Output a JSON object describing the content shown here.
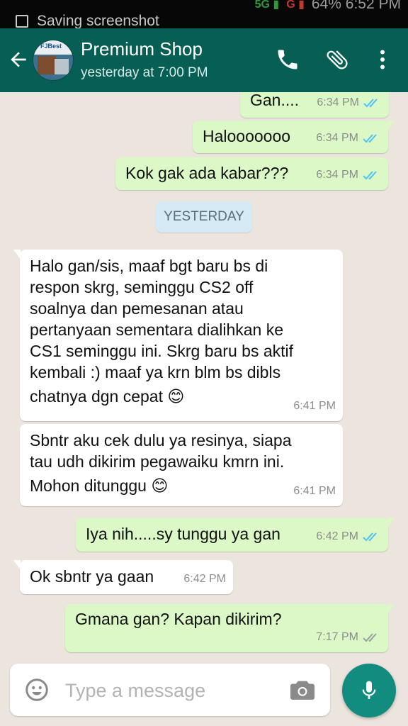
{
  "status_bar": {
    "notification": "Saving screenshot",
    "right_text": "64%  6:52 PM"
  },
  "header": {
    "contact_name": "Premium Shop",
    "last_seen": "yesterday at 7:00 PM",
    "avatar_text": "FJBest"
  },
  "date_divider": "YESTERDAY",
  "messages": [
    {
      "dir": "out",
      "lines": [
        "Gan...."
      ],
      "time": "6:34 PM",
      "status": "read"
    },
    {
      "dir": "out",
      "lines": [
        "Halooooooo"
      ],
      "time": "6:34 PM",
      "status": "read"
    },
    {
      "dir": "out",
      "lines": [
        "Kok gak ada kabar???"
      ],
      "time": "6:34 PM",
      "status": "read"
    },
    {
      "dir": "in",
      "lines": [
        "Halo gan/sis, maaf bgt baru bs di",
        "respon skrg, seminggu CS2 off",
        "soalnya dan pemesanan atau",
        "pertanyaan sementara dialihkan ke",
        "CS1 seminggu ini. Skrg baru bs aktif",
        "kembali :) maaf ya krn blm bs dibls",
        "chatnya dgn cepat 😊"
      ],
      "time": "6:41 PM"
    },
    {
      "dir": "in",
      "lines": [
        "Sbntr aku cek dulu ya resinya, siapa",
        "tau udh dikirim pegawaiku kmrn ini.",
        "Mohon ditunggu 😊"
      ],
      "time": "6:41 PM"
    },
    {
      "dir": "out",
      "lines": [
        "Iya nih.....sy tunggu ya gan"
      ],
      "time": "6:42 PM",
      "status": "read"
    },
    {
      "dir": "in",
      "lines": [
        "Ok sbntr ya gaan"
      ],
      "time": "6:42 PM"
    },
    {
      "dir": "out",
      "lines": [
        "Gmana gan? Kapan dikirim?"
      ],
      "time": "7:17 PM",
      "status": "delivered"
    }
  ],
  "composer": {
    "placeholder": "Type a message"
  },
  "colors": {
    "header": "#075e54",
    "outgoing_bubble": "#dcf8c6",
    "incoming_bubble": "#ffffff",
    "read_ticks": "#4fc3f7",
    "fab": "#128c7e",
    "chat_bg": "#ece5dd"
  },
  "icons": [
    "back-arrow-icon",
    "phone-icon",
    "paperclip-icon",
    "more-vert-icon",
    "emoji-icon",
    "camera-icon",
    "mic-icon",
    "double-check-icon"
  ]
}
